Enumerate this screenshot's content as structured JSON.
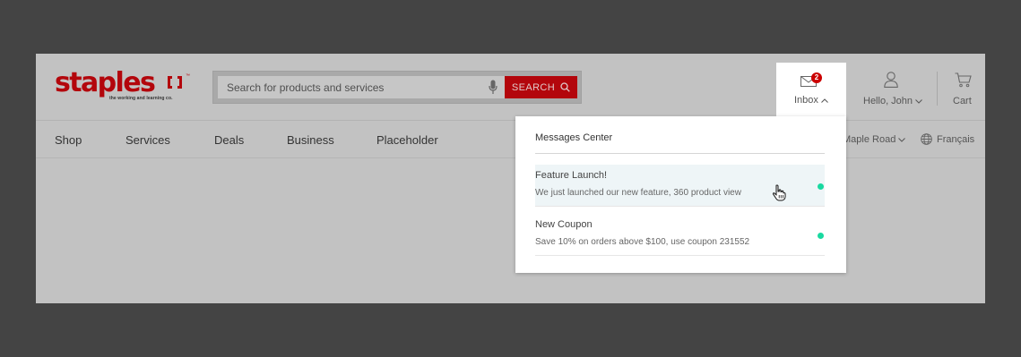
{
  "brand": {
    "name": "staples",
    "tagline": "the working and learning co.",
    "color": "#b3060c"
  },
  "search": {
    "placeholder": "Search for products and services",
    "button_label": "SEARCH",
    "icons": [
      "microphone-icon",
      "search-icon"
    ]
  },
  "header": {
    "inbox": {
      "label": "Inbox",
      "badge_count": "2",
      "icon": "envelope-icon",
      "badge_color": "#cc0000"
    },
    "account": {
      "label": "Hello, John",
      "icon": "user-icon"
    },
    "cart": {
      "label": "Cart",
      "icon": "cart-icon"
    }
  },
  "nav": {
    "items": [
      {
        "label": "Shop"
      },
      {
        "label": "Services"
      },
      {
        "label": "Deals"
      },
      {
        "label": "Business"
      },
      {
        "label": "Placeholder"
      }
    ],
    "store_label": "Maple Road",
    "language_label": "Français"
  },
  "messages_center": {
    "title": "Messages Center",
    "unread_dot_color": "#19d9a0",
    "messages": [
      {
        "title": "Feature Launch!",
        "body": "We just launched our new feature, 360 product view"
      },
      {
        "title": "New Coupon",
        "body": "Save 10% on orders above $100, use coupon 231552"
      }
    ]
  }
}
